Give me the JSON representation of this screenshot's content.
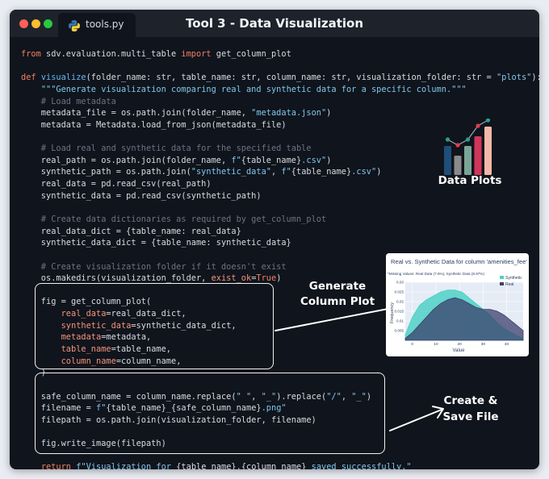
{
  "window": {
    "tab_label": "tools.py",
    "title": "Tool 3 - Data Visualization"
  },
  "code": {
    "lines": [
      [
        [
          "from ",
          "k"
        ],
        [
          "sdv.evaluation.multi_table ",
          ""
        ],
        [
          "import ",
          "k"
        ],
        [
          "get_column_plot",
          ""
        ]
      ],
      [],
      [
        [
          "def ",
          "k"
        ],
        [
          "visualize",
          "f"
        ],
        [
          "(folder_name: str, table_name: str, column_name: str, visualization_folder: str = ",
          ""
        ],
        [
          "\"plots\"",
          "s"
        ],
        [
          "):",
          ""
        ]
      ],
      [
        [
          "    ",
          ""
        ],
        [
          "\"\"\"Generate visualization comparing real and synthetic data for a specific column.\"\"\"",
          "s"
        ]
      ],
      [
        [
          "    # Load metadata",
          "c"
        ]
      ],
      [
        [
          "    metadata_file = os.path.join(folder_name, ",
          ""
        ],
        [
          "\"metadata.json\"",
          "s"
        ],
        [
          ")",
          ""
        ]
      ],
      [
        [
          "    metadata = Metadata.load_from_json(metadata_file)",
          ""
        ]
      ],
      [],
      [
        [
          "    # Load real and synthetic data for the specified table",
          "c"
        ]
      ],
      [
        [
          "    real_path = os.path.join(folder_name, ",
          ""
        ],
        [
          "f\"",
          "s"
        ],
        [
          "{table_name}",
          ""
        ],
        [
          ".csv\"",
          "s"
        ],
        [
          ")",
          ""
        ]
      ],
      [
        [
          "    synthetic_path = os.path.join(",
          ""
        ],
        [
          "\"synthetic_data\"",
          "s"
        ],
        [
          ", ",
          ""
        ],
        [
          "f\"",
          "s"
        ],
        [
          "{table_name}",
          ""
        ],
        [
          ".csv\"",
          "s"
        ],
        [
          ")",
          ""
        ]
      ],
      [
        [
          "    real_data = pd.read_csv(real_path)",
          ""
        ]
      ],
      [
        [
          "    synthetic_data = pd.read_csv(synthetic_path)",
          ""
        ]
      ],
      [],
      [
        [
          "    # Create data dictionaries as required by get_column_plot",
          "c"
        ]
      ],
      [
        [
          "    real_data_dict = {table_name: real_data}",
          ""
        ]
      ],
      [
        [
          "    synthetic_data_dict = {table_name: synthetic_data}",
          ""
        ]
      ],
      [],
      [
        [
          "    # Create visualization folder if it doesn't exist",
          "c"
        ]
      ],
      [
        [
          "    os.makedirs(visualization_folder, ",
          ""
        ],
        [
          "exist_ok",
          "p"
        ],
        [
          "=",
          ""
        ],
        [
          "True",
          "b"
        ],
        [
          ")",
          ""
        ]
      ],
      [],
      [
        [
          "    fig = get_column_plot(",
          ""
        ]
      ],
      [
        [
          "        ",
          ""
        ],
        [
          "real_data",
          "p"
        ],
        [
          "=real_data_dict,",
          ""
        ]
      ],
      [
        [
          "        ",
          ""
        ],
        [
          "synthetic_data",
          "p"
        ],
        [
          "=synthetic_data_dict,",
          ""
        ]
      ],
      [
        [
          "        ",
          ""
        ],
        [
          "metadata",
          "p"
        ],
        [
          "=metadata,",
          ""
        ]
      ],
      [
        [
          "        ",
          ""
        ],
        [
          "table_name",
          "p"
        ],
        [
          "=table_name,",
          ""
        ]
      ],
      [
        [
          "        ",
          ""
        ],
        [
          "column_name",
          "p"
        ],
        [
          "=column_name,",
          ""
        ]
      ],
      [
        [
          "    )",
          ""
        ]
      ],
      [],
      [
        [
          "    safe_column_name = column_name.replace(",
          ""
        ],
        [
          "\" \"",
          "s"
        ],
        [
          ", ",
          ""
        ],
        [
          "\"_\"",
          "s"
        ],
        [
          ").replace(",
          ""
        ],
        [
          "\"/\"",
          "s"
        ],
        [
          ", ",
          ""
        ],
        [
          "\"_\"",
          "s"
        ],
        [
          ")",
          ""
        ]
      ],
      [
        [
          "    filename = ",
          ""
        ],
        [
          "f\"",
          "s"
        ],
        [
          "{table_name}",
          ""
        ],
        [
          "_",
          "s"
        ],
        [
          "{safe_column_name}",
          ""
        ],
        [
          ".png\"",
          "s"
        ]
      ],
      [
        [
          "    filepath = os.path.join(visualization_folder, filename)",
          ""
        ]
      ],
      [],
      [
        [
          "    fig.write_image(filepath)",
          ""
        ]
      ],
      [],
      [
        [
          "    ",
          ""
        ],
        [
          "return ",
          "k"
        ],
        [
          "f\"Visualization for ",
          "s"
        ],
        [
          "{table_name}",
          ""
        ],
        [
          ".",
          "s"
        ],
        [
          "{column_name}",
          ""
        ],
        [
          " saved successfully.\"",
          "s"
        ]
      ]
    ]
  },
  "annotations": {
    "data_plots": "Data Plots",
    "generate_line1": "Generate",
    "generate_line2": "Column Plot",
    "create_line1": "Create &",
    "save_line2": "Save File"
  },
  "icon_names": [
    "python-icon",
    "bar-chart-icon",
    "arrow-icon"
  ],
  "colors": {
    "synthetic": "#4fd1c5",
    "real": "#3b3f6b",
    "code_keyword": "#f07f62",
    "code_string": "#7fc7ec",
    "code_function": "#63b7f2",
    "code_comment": "#6b7384"
  },
  "chart_card": {
    "title": "Real vs. Synthetic Data for column 'amenities_fee'",
    "subtitle": "*Missing Values: Real Data (7.6%), Synthetic Data (8.97%)",
    "xlabel": "Value",
    "ylabel": "Frequency",
    "legend": [
      "Synthetic",
      "Real"
    ]
  },
  "chart_data": {
    "type": "area",
    "title": "Real vs. Synthetic Data for column 'amenities_fee'",
    "subtitle": "*Missing Values: Real Data (7.6%), Synthetic Data (8.97%)",
    "xlabel": "Value",
    "ylabel": "Frequency",
    "xlim": [
      -3,
      47
    ],
    "ylim": [
      0,
      0.03
    ],
    "xticks": [
      0,
      10,
      20,
      30,
      40
    ],
    "yticks": [
      0.005,
      0.01,
      0.015,
      0.02,
      0.025,
      0.03
    ],
    "legend_position": "top-right",
    "x": [
      -3,
      0,
      3,
      6,
      9,
      12,
      15,
      18,
      21,
      24,
      27,
      30,
      33,
      36,
      39,
      42,
      45,
      47
    ],
    "series": [
      {
        "name": "Synthetic",
        "color": "#4fd1c5",
        "values": [
          0.003,
          0.012,
          0.018,
          0.021,
          0.023,
          0.025,
          0.026,
          0.026,
          0.025,
          0.022,
          0.019,
          0.016,
          0.013,
          0.009,
          0.006,
          0.004,
          0.002,
          0.001
        ]
      },
      {
        "name": "Real",
        "color": "#3b3f6b",
        "values": [
          0.001,
          0.004,
          0.008,
          0.012,
          0.016,
          0.019,
          0.021,
          0.022,
          0.021,
          0.019,
          0.017,
          0.016,
          0.016,
          0.015,
          0.013,
          0.01,
          0.007,
          0.005
        ]
      }
    ]
  },
  "icon_chart": {
    "values": [
      3,
      2,
      3,
      4,
      5
    ],
    "colors": [
      "#1f4e79",
      "#8a8a8a",
      "#7aa596",
      "#d1365a",
      "#f4b8a8"
    ],
    "dots": [
      "#2a9d8f",
      "#e63946",
      "#2a9d8f",
      "#e63946",
      "#2a9d8f"
    ]
  }
}
